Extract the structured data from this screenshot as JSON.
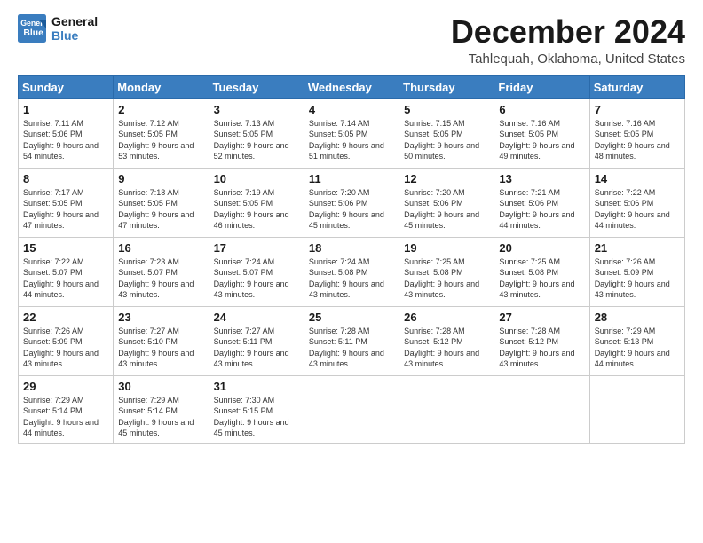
{
  "logo": {
    "line1": "General",
    "line2": "Blue"
  },
  "header": {
    "month": "December 2024",
    "location": "Tahlequah, Oklahoma, United States"
  },
  "days_of_week": [
    "Sunday",
    "Monday",
    "Tuesday",
    "Wednesday",
    "Thursday",
    "Friday",
    "Saturday"
  ],
  "weeks": [
    [
      {
        "day": 1,
        "sunrise": "7:11 AM",
        "sunset": "5:06 PM",
        "daylight": "9 hours and 54 minutes."
      },
      {
        "day": 2,
        "sunrise": "7:12 AM",
        "sunset": "5:05 PM",
        "daylight": "9 hours and 53 minutes."
      },
      {
        "day": 3,
        "sunrise": "7:13 AM",
        "sunset": "5:05 PM",
        "daylight": "9 hours and 52 minutes."
      },
      {
        "day": 4,
        "sunrise": "7:14 AM",
        "sunset": "5:05 PM",
        "daylight": "9 hours and 51 minutes."
      },
      {
        "day": 5,
        "sunrise": "7:15 AM",
        "sunset": "5:05 PM",
        "daylight": "9 hours and 50 minutes."
      },
      {
        "day": 6,
        "sunrise": "7:16 AM",
        "sunset": "5:05 PM",
        "daylight": "9 hours and 49 minutes."
      },
      {
        "day": 7,
        "sunrise": "7:16 AM",
        "sunset": "5:05 PM",
        "daylight": "9 hours and 48 minutes."
      }
    ],
    [
      {
        "day": 8,
        "sunrise": "7:17 AM",
        "sunset": "5:05 PM",
        "daylight": "9 hours and 47 minutes."
      },
      {
        "day": 9,
        "sunrise": "7:18 AM",
        "sunset": "5:05 PM",
        "daylight": "9 hours and 47 minutes."
      },
      {
        "day": 10,
        "sunrise": "7:19 AM",
        "sunset": "5:05 PM",
        "daylight": "9 hours and 46 minutes."
      },
      {
        "day": 11,
        "sunrise": "7:20 AM",
        "sunset": "5:06 PM",
        "daylight": "9 hours and 45 minutes."
      },
      {
        "day": 12,
        "sunrise": "7:20 AM",
        "sunset": "5:06 PM",
        "daylight": "9 hours and 45 minutes."
      },
      {
        "day": 13,
        "sunrise": "7:21 AM",
        "sunset": "5:06 PM",
        "daylight": "9 hours and 44 minutes."
      },
      {
        "day": 14,
        "sunrise": "7:22 AM",
        "sunset": "5:06 PM",
        "daylight": "9 hours and 44 minutes."
      }
    ],
    [
      {
        "day": 15,
        "sunrise": "7:22 AM",
        "sunset": "5:07 PM",
        "daylight": "9 hours and 44 minutes."
      },
      {
        "day": 16,
        "sunrise": "7:23 AM",
        "sunset": "5:07 PM",
        "daylight": "9 hours and 43 minutes."
      },
      {
        "day": 17,
        "sunrise": "7:24 AM",
        "sunset": "5:07 PM",
        "daylight": "9 hours and 43 minutes."
      },
      {
        "day": 18,
        "sunrise": "7:24 AM",
        "sunset": "5:08 PM",
        "daylight": "9 hours and 43 minutes."
      },
      {
        "day": 19,
        "sunrise": "7:25 AM",
        "sunset": "5:08 PM",
        "daylight": "9 hours and 43 minutes."
      },
      {
        "day": 20,
        "sunrise": "7:25 AM",
        "sunset": "5:08 PM",
        "daylight": "9 hours and 43 minutes."
      },
      {
        "day": 21,
        "sunrise": "7:26 AM",
        "sunset": "5:09 PM",
        "daylight": "9 hours and 43 minutes."
      }
    ],
    [
      {
        "day": 22,
        "sunrise": "7:26 AM",
        "sunset": "5:09 PM",
        "daylight": "9 hours and 43 minutes."
      },
      {
        "day": 23,
        "sunrise": "7:27 AM",
        "sunset": "5:10 PM",
        "daylight": "9 hours and 43 minutes."
      },
      {
        "day": 24,
        "sunrise": "7:27 AM",
        "sunset": "5:11 PM",
        "daylight": "9 hours and 43 minutes."
      },
      {
        "day": 25,
        "sunrise": "7:28 AM",
        "sunset": "5:11 PM",
        "daylight": "9 hours and 43 minutes."
      },
      {
        "day": 26,
        "sunrise": "7:28 AM",
        "sunset": "5:12 PM",
        "daylight": "9 hours and 43 minutes."
      },
      {
        "day": 27,
        "sunrise": "7:28 AM",
        "sunset": "5:12 PM",
        "daylight": "9 hours and 43 minutes."
      },
      {
        "day": 28,
        "sunrise": "7:29 AM",
        "sunset": "5:13 PM",
        "daylight": "9 hours and 44 minutes."
      }
    ],
    [
      {
        "day": 29,
        "sunrise": "7:29 AM",
        "sunset": "5:14 PM",
        "daylight": "9 hours and 44 minutes."
      },
      {
        "day": 30,
        "sunrise": "7:29 AM",
        "sunset": "5:14 PM",
        "daylight": "9 hours and 45 minutes."
      },
      {
        "day": 31,
        "sunrise": "7:30 AM",
        "sunset": "5:15 PM",
        "daylight": "9 hours and 45 minutes."
      },
      null,
      null,
      null,
      null
    ]
  ],
  "labels": {
    "sunrise": "Sunrise:",
    "sunset": "Sunset:",
    "daylight": "Daylight:"
  }
}
